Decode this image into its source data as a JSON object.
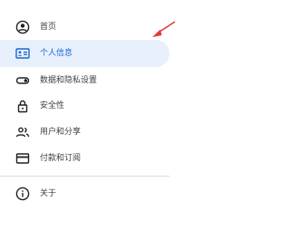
{
  "nav": {
    "items": [
      {
        "label": "首页",
        "icon": "account-circle-icon",
        "active": false
      },
      {
        "label": "个人信息",
        "icon": "id-card-icon",
        "active": true
      },
      {
        "label": "数据和隐私设置",
        "icon": "toggle-icon",
        "active": false
      },
      {
        "label": "安全性",
        "icon": "lock-icon",
        "active": false
      },
      {
        "label": "用户和分享",
        "icon": "people-icon",
        "active": false
      },
      {
        "label": "付款和订阅",
        "icon": "credit-card-icon",
        "active": false
      }
    ],
    "footer_items": [
      {
        "label": "关于",
        "icon": "info-icon",
        "active": false
      }
    ]
  },
  "colors": {
    "active_bg": "#e8f0fe",
    "active_text": "#1967d2",
    "text": "#3c4043",
    "icon": "#202124",
    "annotation_arrow": "#e53935"
  }
}
